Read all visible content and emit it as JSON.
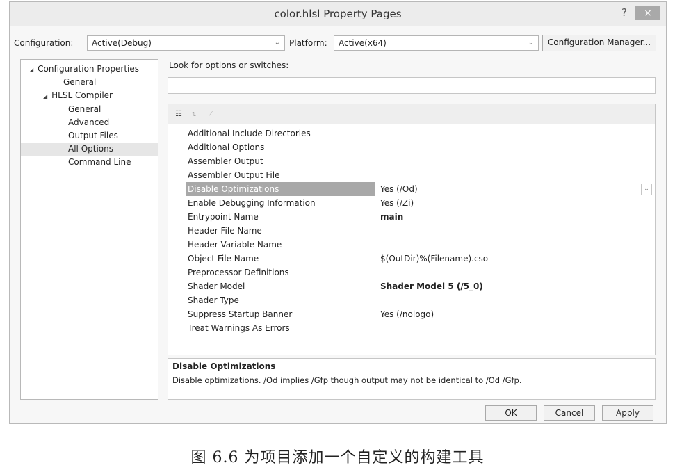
{
  "window": {
    "title": "color.hlsl Property Pages",
    "help_label": "?",
    "close_label": "×"
  },
  "config_bar": {
    "configuration_label": "Configuration:",
    "configuration_value": "Active(Debug)",
    "platform_label": "Platform:",
    "platform_value": "Active(x64)",
    "config_manager_label": "Configuration Manager..."
  },
  "tree": {
    "items": [
      {
        "label": "Configuration Properties",
        "expanded": true
      },
      {
        "label": "General"
      },
      {
        "label": "HLSL Compiler",
        "expanded": true
      },
      {
        "label": "General"
      },
      {
        "label": "Advanced"
      },
      {
        "label": "Output Files"
      },
      {
        "label": "All Options",
        "selected": true
      },
      {
        "label": "Command Line"
      }
    ]
  },
  "search": {
    "label": "Look for options or switches:",
    "value": ""
  },
  "toolbar": {
    "icons": [
      "categorized-icon",
      "sort-alpha-icon",
      "property-pages-icon"
    ]
  },
  "properties": [
    {
      "name": "Additional Include Directories",
      "value": ""
    },
    {
      "name": "Additional Options",
      "value": ""
    },
    {
      "name": "Assembler Output",
      "value": ""
    },
    {
      "name": "Assembler Output File",
      "value": ""
    },
    {
      "name": "Disable Optimizations",
      "value": "Yes (/Od)",
      "selected": true
    },
    {
      "name": "Enable Debugging Information",
      "value": "Yes (/Zi)"
    },
    {
      "name": "Entrypoint Name",
      "value": "main",
      "bold": true
    },
    {
      "name": "Header File Name",
      "value": ""
    },
    {
      "name": "Header Variable Name",
      "value": ""
    },
    {
      "name": "Object File Name",
      "value": "$(OutDir)%(Filename).cso"
    },
    {
      "name": "Preprocessor Definitions",
      "value": ""
    },
    {
      "name": "Shader Model",
      "value": "Shader Model 5 (/5_0)",
      "bold": true
    },
    {
      "name": "Shader Type",
      "value": ""
    },
    {
      "name": "Suppress Startup Banner",
      "value": "Yes (/nologo)"
    },
    {
      "name": "Treat Warnings As Errors",
      "value": ""
    }
  ],
  "description": {
    "title": "Disable Optimizations",
    "text": "Disable optimizations. /Od implies /Gfp though output may not be identical to /Od /Gfp."
  },
  "buttons": {
    "ok": "OK",
    "cancel": "Cancel",
    "apply": "Apply"
  },
  "caption": "图 6.6   为项目添加一个自定义的构建工具"
}
